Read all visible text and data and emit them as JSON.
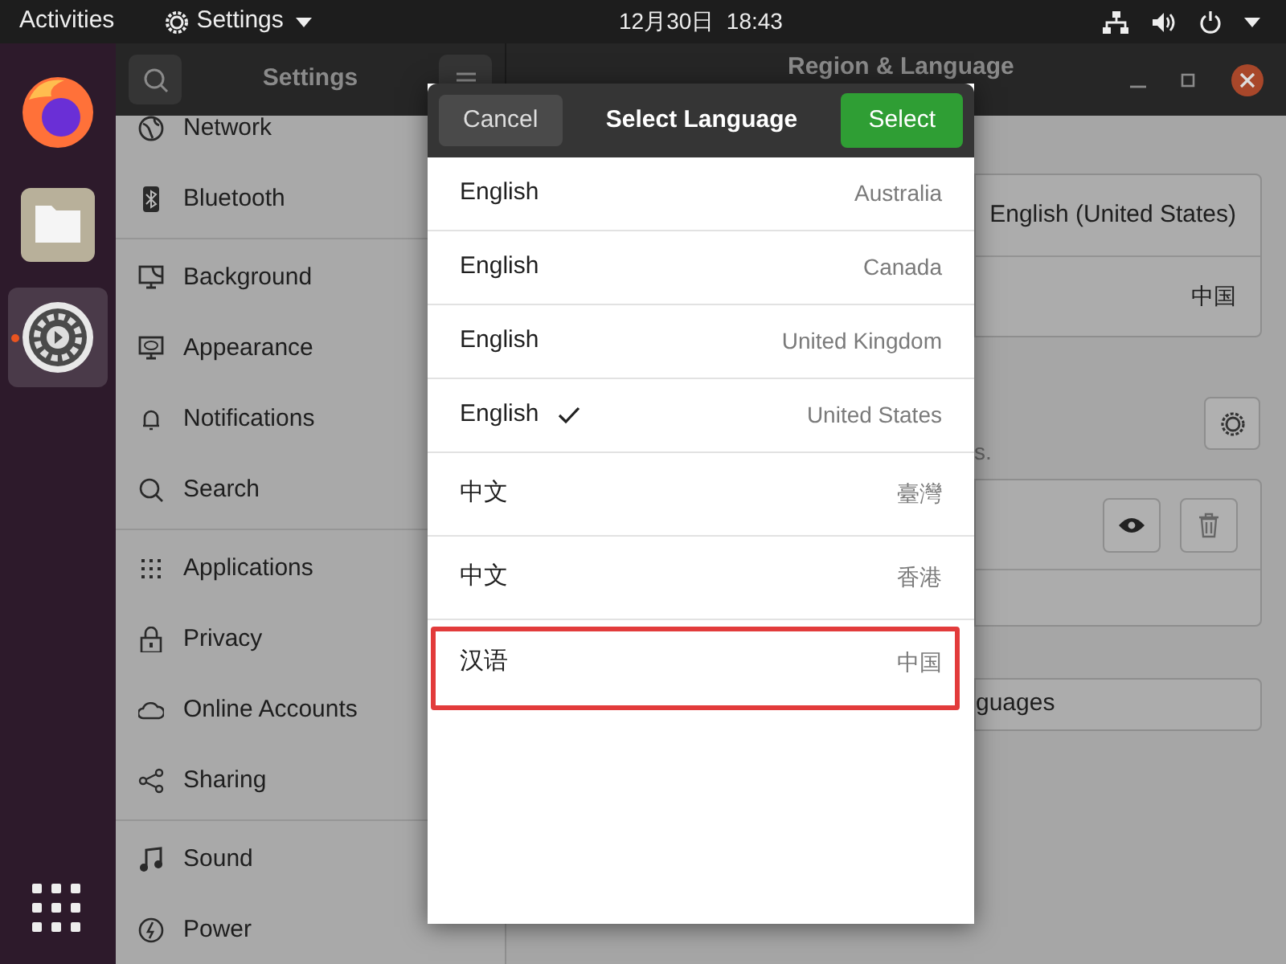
{
  "top_bar": {
    "activities": "Activities",
    "app_menu": "Settings",
    "clock": "12月30日  18:43"
  },
  "dock": {
    "items": [
      {
        "kind": "browser",
        "running": false,
        "selected": false
      },
      {
        "kind": "files",
        "running": false,
        "selected": false
      },
      {
        "kind": "settings",
        "running": true,
        "selected": true
      }
    ]
  },
  "window": {
    "sidebar_title": "Settings",
    "title": "Region & Language"
  },
  "sidebar": {
    "groups": [
      [
        {
          "label": "Network"
        },
        {
          "label": "Bluetooth"
        }
      ],
      [
        {
          "label": "Background"
        },
        {
          "label": "Appearance"
        },
        {
          "label": "Notifications"
        },
        {
          "label": "Search"
        }
      ],
      [
        {
          "label": "Applications"
        },
        {
          "label": "Privacy"
        },
        {
          "label": "Online Accounts"
        },
        {
          "label": "Sharing"
        }
      ],
      [
        {
          "label": "Sound"
        },
        {
          "label": "Power"
        }
      ]
    ]
  },
  "content": {
    "language_value": "English (United States)",
    "formats_value": "中国",
    "note_end": "s.",
    "manage_button": "guages"
  },
  "dialog": {
    "cancel": "Cancel",
    "title": "Select Language",
    "select": "Select",
    "languages": [
      {
        "language": "English",
        "region": "Australia",
        "checked": false,
        "highlighted": false
      },
      {
        "language": "English",
        "region": "Canada",
        "checked": false,
        "highlighted": false
      },
      {
        "language": "English",
        "region": "United Kingdom",
        "checked": false,
        "highlighted": false
      },
      {
        "language": "English",
        "region": "United States",
        "checked": true,
        "highlighted": false
      },
      {
        "language": "中文",
        "region": "臺灣",
        "checked": false,
        "highlighted": false
      },
      {
        "language": "中文",
        "region": "香港",
        "checked": false,
        "highlighted": false
      },
      {
        "language": "汉语",
        "region": "中国",
        "checked": false,
        "highlighted": true
      }
    ]
  }
}
